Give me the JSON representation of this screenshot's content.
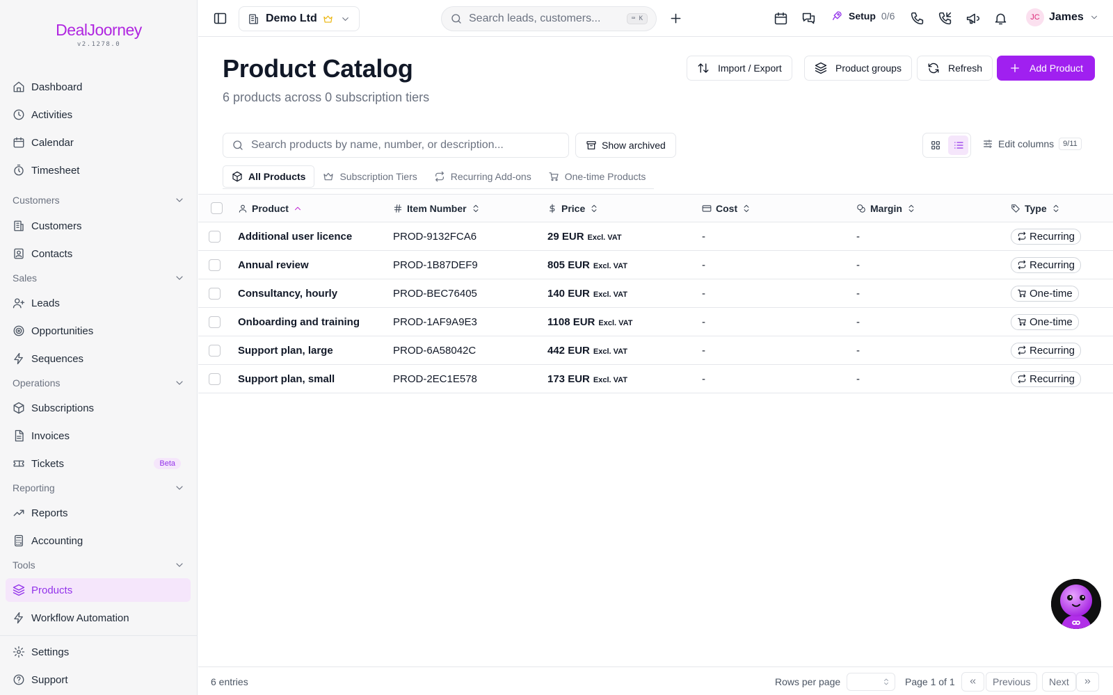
{
  "brand": {
    "logo": "DealJoorney",
    "version": "v2.1278.0"
  },
  "sidebar": {
    "items_top": [
      {
        "label": "Dashboard",
        "icon": "home-icon"
      },
      {
        "label": "Activities",
        "icon": "clock-icon"
      },
      {
        "label": "Calendar",
        "icon": "calendar-icon"
      },
      {
        "label": "Timesheet",
        "icon": "timer-icon"
      }
    ],
    "sections": {
      "customers": "Customers",
      "sales": "Sales",
      "operations": "Operations",
      "reporting": "Reporting",
      "tools": "Tools"
    },
    "items": {
      "customers": "Customers",
      "contacts": "Contacts",
      "leads": "Leads",
      "opportunities": "Opportunities",
      "sequences": "Sequences",
      "subscriptions": "Subscriptions",
      "invoices": "Invoices",
      "tickets": "Tickets",
      "tickets_badge": "Beta",
      "reports": "Reports",
      "accounting": "Accounting",
      "products": "Products",
      "workflow": "Workflow Automation",
      "settings": "Settings",
      "support": "Support"
    },
    "active": "Products"
  },
  "topbar": {
    "company": "Demo Ltd",
    "search_placeholder": "Search leads, customers...",
    "search_shortcut": "⌨ K",
    "setup_label": "Setup",
    "setup_progress": "0/6",
    "user_initials": "JC",
    "user_name": "James"
  },
  "page": {
    "title": "Product Catalog",
    "subtitle": "6 products across 0 subscription tiers",
    "buttons": {
      "import_export": "Import / Export",
      "product_groups": "Product groups",
      "refresh": "Refresh",
      "add_product": "Add Product"
    },
    "search_placeholder": "Search products by name, number, or description...",
    "show_archived": "Show archived",
    "edit_columns": "Edit columns",
    "columns_count": "9/11",
    "view_mode": "list"
  },
  "tabs": [
    {
      "label": "All Products",
      "active": true
    },
    {
      "label": "Subscription Tiers",
      "active": false
    },
    {
      "label": "Recurring Add-ons",
      "active": false
    },
    {
      "label": "One-time Products",
      "active": false
    }
  ],
  "table": {
    "columns": {
      "product": "Product",
      "item_number": "Item Number",
      "price": "Price",
      "cost": "Cost",
      "margin": "Margin",
      "type": "Type"
    },
    "sorted_by": "Product",
    "sort_direction": "asc",
    "rows": [
      {
        "product": "Additional user licence",
        "item_number": "PROD-9132FCA6",
        "price": "29 EUR",
        "vat": "Excl. VAT",
        "cost": "-",
        "margin": "-",
        "type": "Recurring"
      },
      {
        "product": "Annual review",
        "item_number": "PROD-1B87DEF9",
        "price": "805 EUR",
        "vat": "Excl. VAT",
        "cost": "-",
        "margin": "-",
        "type": "Recurring"
      },
      {
        "product": "Consultancy, hourly",
        "item_number": "PROD-BEC76405",
        "price": "140 EUR",
        "vat": "Excl. VAT",
        "cost": "-",
        "margin": "-",
        "type": "One-time"
      },
      {
        "product": "Onboarding and training",
        "item_number": "PROD-1AF9A9E3",
        "price": "1108 EUR",
        "vat": "Excl. VAT",
        "cost": "-",
        "margin": "-",
        "type": "One-time"
      },
      {
        "product": "Support plan, large",
        "item_number": "PROD-6A58042C",
        "price": "442 EUR",
        "vat": "Excl. VAT",
        "cost": "-",
        "margin": "-",
        "type": "Recurring"
      },
      {
        "product": "Support plan, small",
        "item_number": "PROD-2EC1E578",
        "price": "173 EUR",
        "vat": "Excl. VAT",
        "cost": "-",
        "margin": "-",
        "type": "Recurring"
      }
    ]
  },
  "footer": {
    "entries": "6 entries",
    "rows_per_page_label": "Rows per page",
    "page_info": "Page 1 of 1",
    "previous": "Previous",
    "next": "Next"
  },
  "colors": {
    "accent": "#a020f0",
    "active_bg": "#f5e6fb",
    "logo": "#b026e0"
  }
}
